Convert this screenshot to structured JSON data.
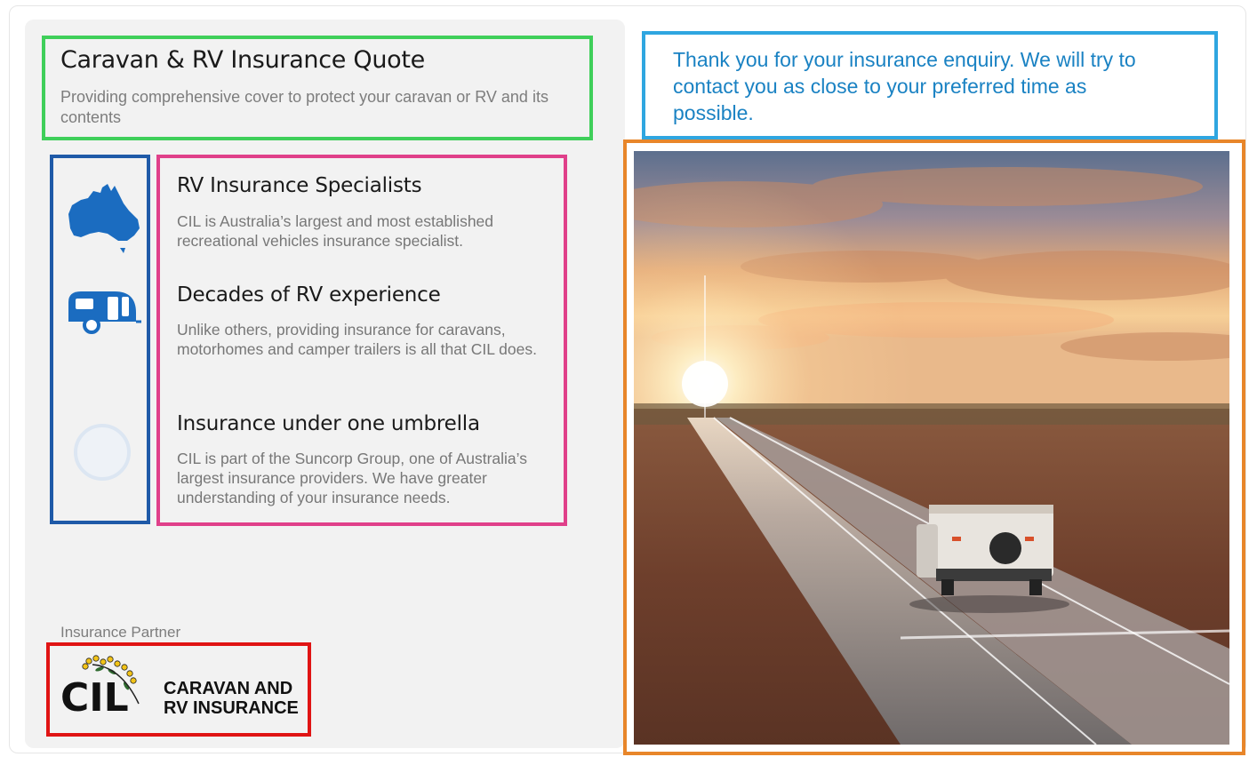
{
  "header": {
    "title": "Caravan & RV Insurance Quote",
    "subtitle": "Providing comprehensive cover to protect your caravan or RV and its contents"
  },
  "features": [
    {
      "icon": "australia-map-icon",
      "heading": "RV Insurance Specialists",
      "text": "CIL is Australia’s largest and most established recreational vehicles insurance specialist."
    },
    {
      "icon": "caravan-icon",
      "heading": "Decades of RV experience",
      "text": "Unlike others, providing insurance for caravans, motorhomes and camper trailers is all that CIL does."
    },
    {
      "icon": "loading-circle-icon",
      "heading": "Insurance under one umbrella",
      "text": "CIL is part of the Suncorp Group, one of Australia’s largest insurance providers. We have greater understanding of your insurance needs."
    }
  ],
  "partner": {
    "label": "Insurance Partner",
    "logo_mark": "CIL",
    "logo_line1": "CARAVAN AND",
    "logo_line2": "RV INSURANCE"
  },
  "confirmation": {
    "message": "Thank you for your insurance enquiry. We will try to contact you as close to your preferred time as possible."
  },
  "colors": {
    "accent_blue": "#1a82c3",
    "icon_blue": "#1b6cc0",
    "annotation_green": "#3fcf5a",
    "annotation_navy": "#1f5aa8",
    "annotation_pink": "#e0408a",
    "annotation_red": "#e01414",
    "annotation_lightblue": "#2fa6e0",
    "annotation_orange": "#e8862a"
  }
}
